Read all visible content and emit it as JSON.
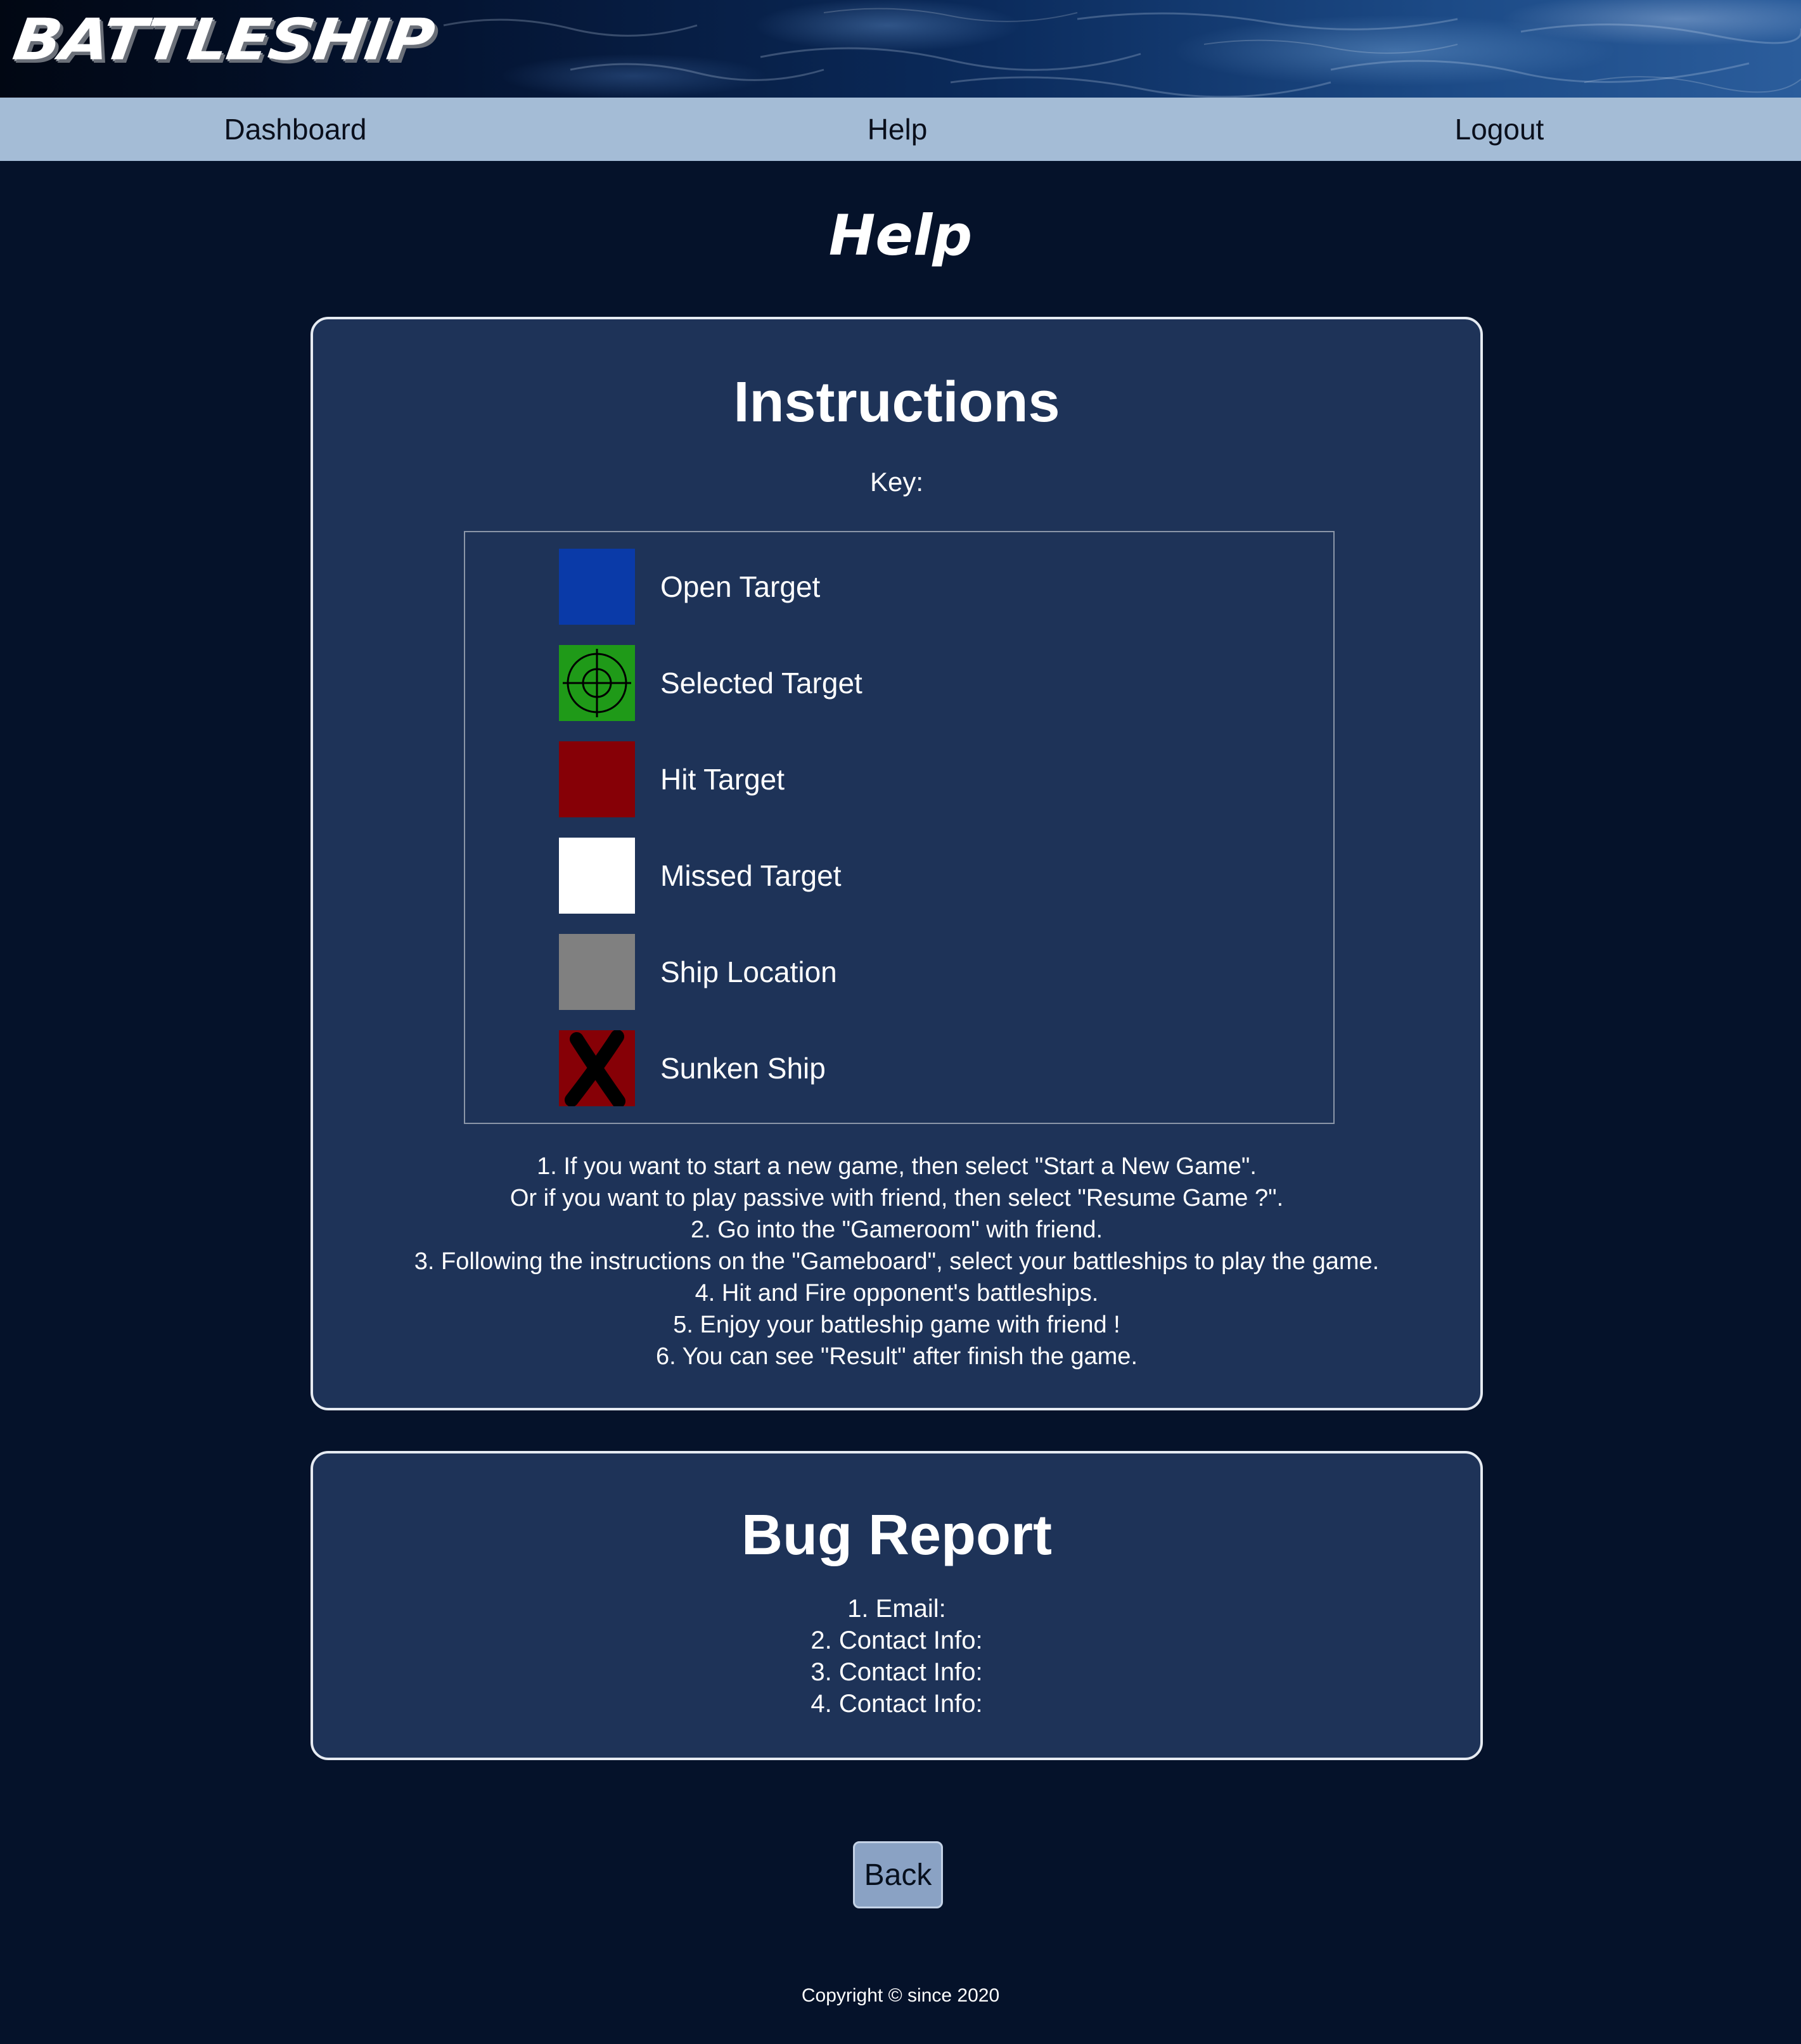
{
  "header": {
    "logo_text": "BATTLESHIP"
  },
  "nav": {
    "items": [
      {
        "label": "Dashboard"
      },
      {
        "label": "Help"
      },
      {
        "label": "Logout"
      }
    ]
  },
  "page": {
    "title": "Help"
  },
  "instructions": {
    "heading": "Instructions",
    "key_label": "Key:",
    "key": [
      {
        "label": "Open Target",
        "color": "#0a3aa8",
        "icon": "open-target"
      },
      {
        "label": "Selected Target",
        "color": "#1f9a18",
        "icon": "crosshair-icon"
      },
      {
        "label": "Hit Target",
        "color": "#860006",
        "icon": "hit-target"
      },
      {
        "label": "Missed Target",
        "color": "#ffffff",
        "icon": "missed-target"
      },
      {
        "label": "Ship Location",
        "color": "#808080",
        "icon": "ship-location"
      },
      {
        "label": "Sunken Ship",
        "color": "#860006",
        "icon": "x-mark-icon"
      }
    ],
    "steps": [
      "1. If you want to start a new game, then select \"Start a New Game\".",
      "Or if you want to play passive with friend, then select \"Resume Game ?\".",
      "2. Go into the \"Gameroom\" with friend.",
      "3. Following the instructions on the \"Gameboard\", select your battleships to play the game.",
      "4. Hit and Fire opponent's battleships.",
      "5. Enjoy your battleship game with friend !",
      "6. You can see \"Result\" after finish the game."
    ]
  },
  "bug_report": {
    "heading": "Bug Report",
    "items": [
      "1. Email:",
      "2. Contact Info:",
      "3. Contact Info:",
      "4. Contact Info:"
    ]
  },
  "actions": {
    "back_label": "Back"
  },
  "footer": {
    "copyright": "Copyright © since 2020"
  },
  "colors": {
    "background": "#05122a",
    "panel": "#1e3358",
    "nav": "#a4bcd6",
    "button": "#8aa2c4"
  }
}
